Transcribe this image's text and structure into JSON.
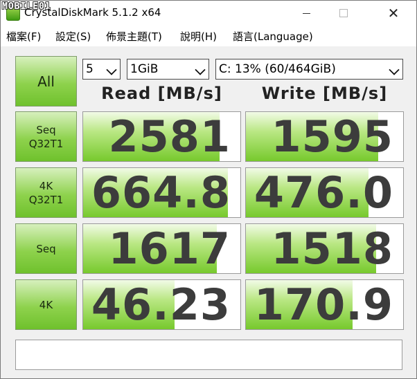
{
  "window": {
    "title": "CrystalDiskMark 5.1.2 x64",
    "watermark": "MOBILE01",
    "controls": {
      "minimize": "—",
      "maximize": "☐",
      "close": "✕"
    }
  },
  "menu": [
    "檔案(F)",
    "設定(S)",
    "佈景主題(T)",
    "說明(H)",
    "語言(Language)"
  ],
  "controls": {
    "all_label": "All",
    "count_value": "5",
    "size_value": "1GiB",
    "drive_value": "C: 13% (60/464GiB)"
  },
  "headers": {
    "read": "Read [MB/s]",
    "write": "Write [MB/s]"
  },
  "tests": [
    {
      "label": "Seq\nQ32T1",
      "read": "2581",
      "write": "1595",
      "read_fill": 0.87,
      "write_fill": 0.84
    },
    {
      "label": "4K\nQ32T1",
      "read": "664.8",
      "write": "476.0",
      "read_fill": 0.92,
      "write_fill": 0.78
    },
    {
      "label": "Seq",
      "read": "1617",
      "write": "1518",
      "read_fill": 0.85,
      "write_fill": 0.83
    },
    {
      "label": "4K",
      "read": "46.23",
      "write": "170.9",
      "read_fill": 0.58,
      "write_fill": 0.68
    }
  ],
  "status": ""
}
